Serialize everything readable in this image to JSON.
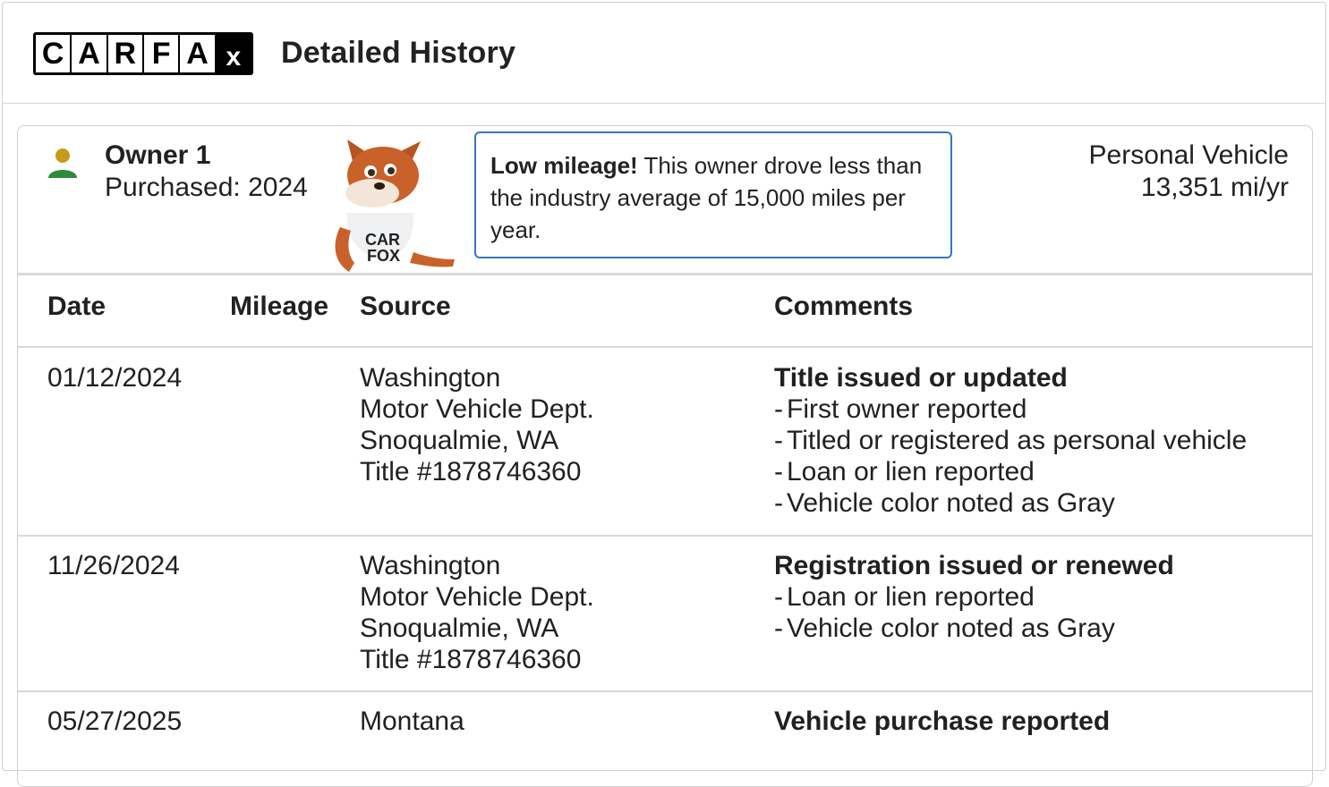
{
  "header": {
    "logo_letters": [
      "C",
      "A",
      "R",
      "F",
      "A",
      "x"
    ],
    "title": "Detailed History"
  },
  "owner": {
    "name": "Owner 1",
    "purchased": "Purchased: 2024",
    "callout_bold": "Low mileage!",
    "callout_text": " This owner drove less than the industry average of 15,000 miles per year.",
    "vehicle_type": "Personal Vehicle",
    "miles_per_year": "13,351 mi/yr",
    "mascot_shirt_text": [
      "CAR",
      "FOX"
    ]
  },
  "table": {
    "headers": {
      "date": "Date",
      "mileage": "Mileage",
      "source": "Source",
      "comments": "Comments"
    },
    "rows": [
      {
        "date": "01/12/2024",
        "mileage": "",
        "source": [
          "Washington",
          "Motor Vehicle Dept.",
          "Snoqualmie, WA",
          "Title #1878746360"
        ],
        "comment_title": "Title issued or updated",
        "comment_items": [
          "First owner reported",
          "Titled or registered as personal vehicle",
          "Loan or lien reported",
          "Vehicle color noted as Gray"
        ]
      },
      {
        "date": "11/26/2024",
        "mileage": "",
        "source": [
          "Washington",
          "Motor Vehicle Dept.",
          "Snoqualmie, WA",
          "Title #1878746360"
        ],
        "comment_title": "Registration issued or renewed",
        "comment_items": [
          "Loan or lien reported",
          "Vehicle color noted as Gray"
        ]
      },
      {
        "date": "05/27/2025",
        "mileage": "",
        "source": [
          "Montana"
        ],
        "comment_title": "Vehicle purchase reported",
        "comment_items": []
      }
    ]
  },
  "colors": {
    "callout_border": "#3777bc",
    "person_head": "#c79a1a",
    "person_body": "#2e8b3e",
    "fox_fur": "#c9622a"
  }
}
